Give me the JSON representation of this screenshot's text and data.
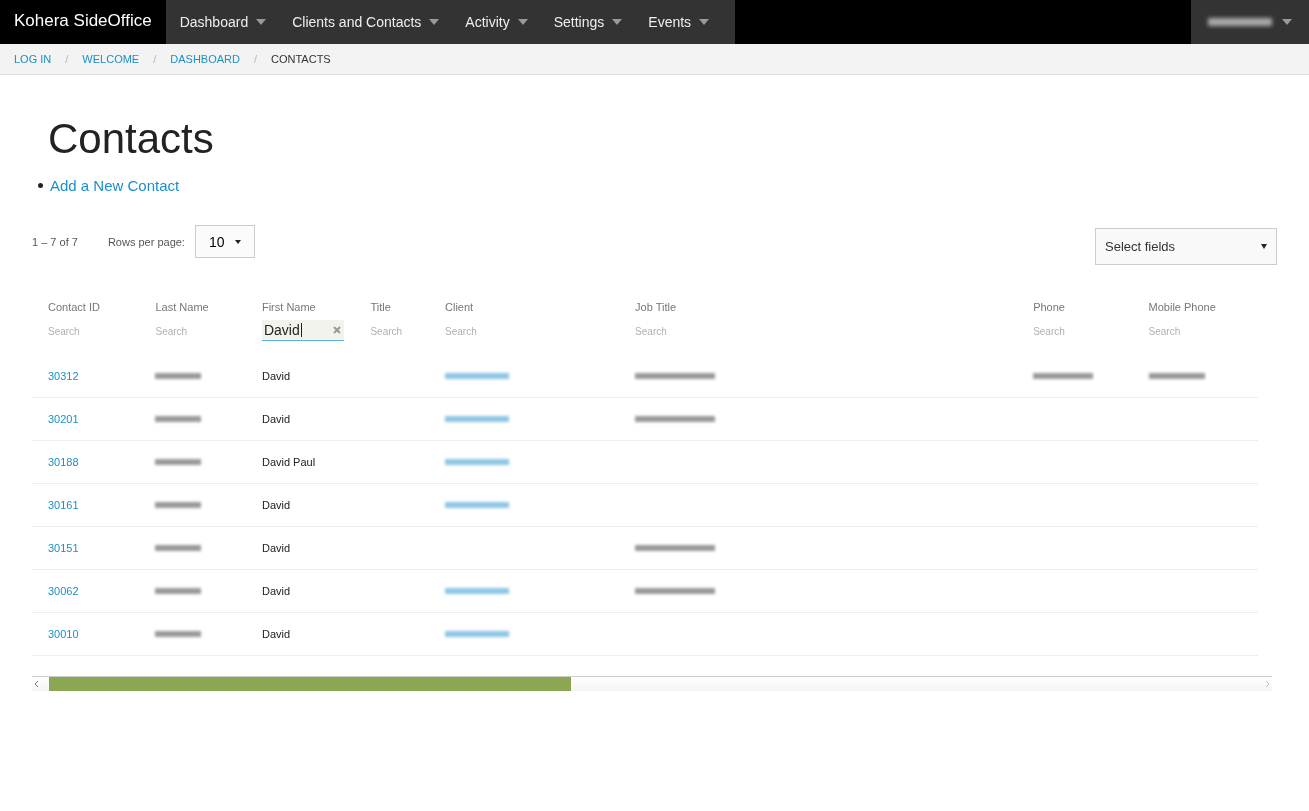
{
  "navbar": {
    "brand": "Kohera SideOffice",
    "menus": [
      {
        "label": "Dashboard"
      },
      {
        "label": "Clients and Contacts"
      },
      {
        "label": "Activity"
      },
      {
        "label": "Settings"
      },
      {
        "label": "Events"
      }
    ],
    "user_menu": {
      "redacted": true
    }
  },
  "breadcrumb": [
    {
      "label": "LOG IN",
      "kind": "link"
    },
    {
      "label": "WELCOME",
      "kind": "link"
    },
    {
      "label": "DASHBOARD",
      "kind": "link"
    },
    {
      "label": "CONTACTS",
      "kind": "current"
    }
  ],
  "separator": "/",
  "heading": "Contacts",
  "actions": [
    "Add a New Contact"
  ],
  "pager": {
    "range": "1 – 7 of 7",
    "rows_label": "Rows per page:",
    "rows_value": "10"
  },
  "select_fields": {
    "placeholder": "Select fields"
  },
  "table": {
    "columns": [
      {
        "label": "Contact ID",
        "filter": {
          "placeholder": "Search"
        }
      },
      {
        "label": "Last Name",
        "filter": {
          "placeholder": "Search"
        }
      },
      {
        "label": "First Name",
        "filter": {
          "value": "David"
        }
      },
      {
        "label": "Title",
        "filter": {
          "placeholder": "Search"
        }
      },
      {
        "label": "Client",
        "filter": {
          "placeholder": "Search"
        }
      },
      {
        "label": "Job Title",
        "filter": {
          "placeholder": "Search"
        }
      },
      {
        "label": "Phone",
        "filter": {
          "placeholder": "Search"
        }
      },
      {
        "label": "Mobile Phone",
        "filter": {
          "placeholder": "Search"
        }
      }
    ],
    "rows": [
      {
        "cells": [
          {
            "kind": "link",
            "text": "30312"
          },
          {
            "kind": "redacted"
          },
          {
            "kind": "text",
            "text": "David"
          },
          {
            "kind": "empty"
          },
          {
            "kind": "redacted-link"
          },
          {
            "kind": "redacted"
          },
          {
            "kind": "redacted"
          },
          {
            "kind": "redacted"
          }
        ]
      },
      {
        "cells": [
          {
            "kind": "link",
            "text": "30201"
          },
          {
            "kind": "redacted"
          },
          {
            "kind": "text",
            "text": "David"
          },
          {
            "kind": "empty"
          },
          {
            "kind": "redacted-link"
          },
          {
            "kind": "redacted"
          },
          {
            "kind": "empty"
          },
          {
            "kind": "empty"
          }
        ]
      },
      {
        "cells": [
          {
            "kind": "link",
            "text": "30188"
          },
          {
            "kind": "redacted"
          },
          {
            "kind": "text",
            "text": "David Paul"
          },
          {
            "kind": "empty"
          },
          {
            "kind": "redacted-link"
          },
          {
            "kind": "empty"
          },
          {
            "kind": "empty"
          },
          {
            "kind": "empty"
          }
        ]
      },
      {
        "cells": [
          {
            "kind": "link",
            "text": "30161"
          },
          {
            "kind": "redacted"
          },
          {
            "kind": "text",
            "text": "David"
          },
          {
            "kind": "empty"
          },
          {
            "kind": "redacted-link"
          },
          {
            "kind": "empty"
          },
          {
            "kind": "empty"
          },
          {
            "kind": "empty"
          }
        ]
      },
      {
        "cells": [
          {
            "kind": "link",
            "text": "30151"
          },
          {
            "kind": "redacted"
          },
          {
            "kind": "text",
            "text": "David"
          },
          {
            "kind": "empty"
          },
          {
            "kind": "empty"
          },
          {
            "kind": "redacted"
          },
          {
            "kind": "empty"
          },
          {
            "kind": "empty"
          }
        ]
      },
      {
        "cells": [
          {
            "kind": "link",
            "text": "30062"
          },
          {
            "kind": "redacted"
          },
          {
            "kind": "text",
            "text": "David"
          },
          {
            "kind": "empty"
          },
          {
            "kind": "redacted-link"
          },
          {
            "kind": "redacted"
          },
          {
            "kind": "empty"
          },
          {
            "kind": "empty"
          }
        ]
      },
      {
        "cells": [
          {
            "kind": "link",
            "text": "30010"
          },
          {
            "kind": "redacted"
          },
          {
            "kind": "text",
            "text": "David"
          },
          {
            "kind": "empty"
          },
          {
            "kind": "redacted-link"
          },
          {
            "kind": "empty"
          },
          {
            "kind": "empty"
          },
          {
            "kind": "empty"
          }
        ]
      }
    ]
  }
}
